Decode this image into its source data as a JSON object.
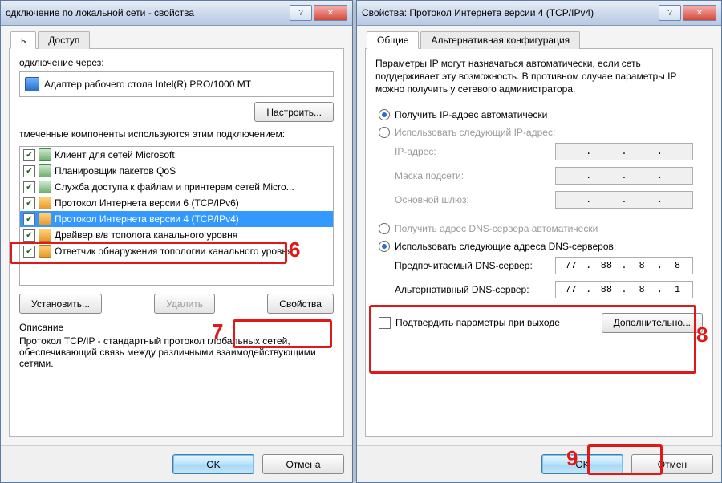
{
  "left": {
    "title": "одключение по локальной сети - свойства",
    "tabs": {
      "net": "ь",
      "access": "Доступ"
    },
    "connect_via": "одключение через:",
    "adapter": "Адаптер рабочего стола Intel(R) PRO/1000 MT",
    "configure": "Настроить...",
    "components_label": "тмеченные компоненты используются этим подключением:",
    "items": {
      "i0": "Клиент для сетей Microsoft",
      "i1": "Планировщик пакетов QoS",
      "i2": "Служба доступа к файлам и принтерам сетей Micro...",
      "i3": "Протокол Интернета версии 6 (TCP/IPv6)",
      "i4": "Протокол Интернета версии 4 (TCP/IPv4)",
      "i5": "Драйвер в/в тополога канального уровня",
      "i6": "Ответчик обнаружения топологии канального уровня"
    },
    "install": "Установить...",
    "remove": "Удалить",
    "properties": "Свойства",
    "desc_head": "Описание",
    "desc_text": "Протокол TCP/IP - стандартный протокол глобальных сетей, обеспечивающий связь между различными взаимодействующими сетями.",
    "ok": "OK",
    "cancel": "Отмена"
  },
  "right": {
    "title": "Свойства: Протокол Интернета версии 4 (TCP/IPv4)",
    "tabs": {
      "general": "Общие",
      "alt": "Альтернативная конфигурация"
    },
    "info": "Параметры IP могут назначаться автоматически, если сеть поддерживает эту возможность. В противном случае параметры IP можно получить у сетевого администратора.",
    "ip_auto": "Получить IP-адрес автоматически",
    "ip_manual": "Использовать следующий IP-адрес:",
    "ip_addr": "IP-адрес:",
    "mask": "Маска подсети:",
    "gateway": "Основной шлюз:",
    "dns_auto": "Получить адрес DNS-сервера автоматически",
    "dns_manual": "Использовать следующие адреса DNS-серверов:",
    "dns_pref": "Предпочитаемый DNS-сервер:",
    "dns_alt": "Альтернативный DNS-сервер:",
    "dns_pref_val": {
      "a": "77",
      "b": "88",
      "c": "8",
      "d": "8"
    },
    "dns_alt_val": {
      "a": "77",
      "b": "88",
      "c": "8",
      "d": "1"
    },
    "validate": "Подтвердить параметры при выходе",
    "advanced": "Дополнительно...",
    "ok": "OK",
    "cancel": "Отмен"
  },
  "anno": {
    "n6": "6",
    "n7": "7",
    "n8": "8",
    "n9": "9"
  }
}
